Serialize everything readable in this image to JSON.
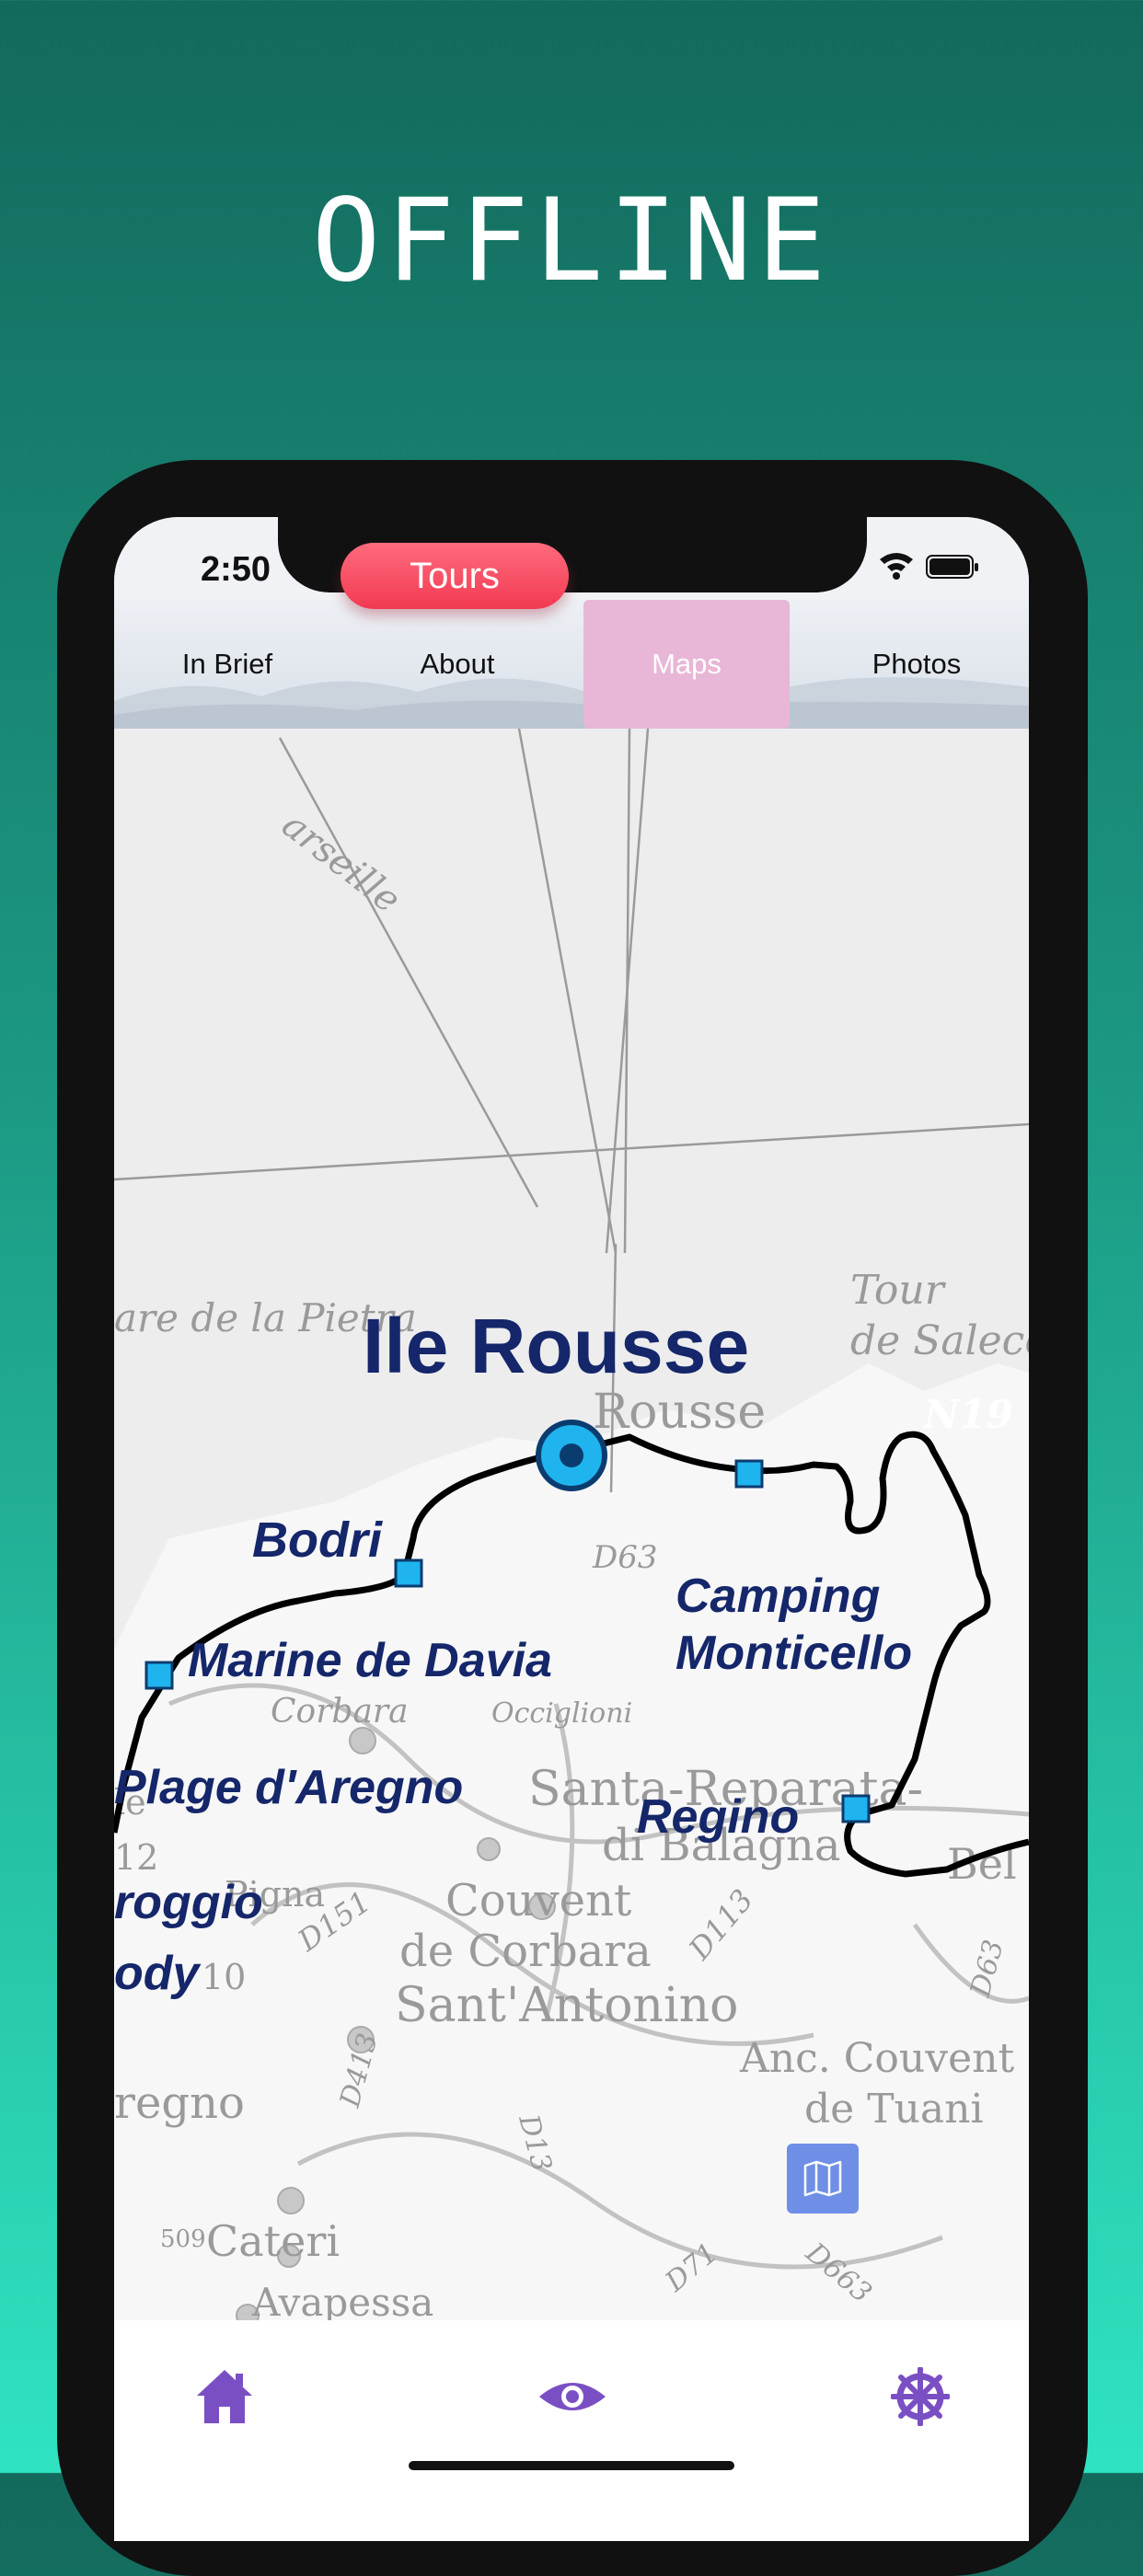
{
  "promo": {
    "headline": "OFFLINE"
  },
  "status_bar": {
    "time": "2:50"
  },
  "tabs": [
    {
      "label": "In Brief",
      "active": false
    },
    {
      "label": "About",
      "active": false
    },
    {
      "label": "Maps",
      "active": true
    },
    {
      "label": "Photos",
      "active": false
    }
  ],
  "map": {
    "tours_label": "Tours",
    "place_title": "Ile Rousse",
    "stops": [
      {
        "label": "Bodri"
      },
      {
        "label": "Marine de Davia"
      },
      {
        "label": "Plage d'Aregno"
      },
      {
        "label": "Camping"
      },
      {
        "label": "Monticello"
      },
      {
        "label": "Regino"
      },
      {
        "label": "roggio"
      },
      {
        "label": "ody"
      }
    ],
    "base_labels": [
      "are de la Pietra",
      "Tour",
      "de Salecci",
      "Rousse",
      "N19",
      "D63",
      "Corbara",
      "Occiglioni",
      "Santa-Reparata-",
      "di Balagna",
      "Couvent",
      "de Corbara",
      "Sant'Antonino",
      "D151",
      "D413",
      "D13",
      "D113",
      "Anc. Couvent",
      "de Tuani",
      "Pigna",
      "12",
      "10",
      "regno",
      "Cateri",
      "Avapessa",
      "509",
      "D71",
      "D663",
      "Bel",
      "D63",
      "arseille",
      "le"
    ]
  },
  "bottom_nav": [
    {
      "icon": "home-icon"
    },
    {
      "icon": "eye-icon"
    },
    {
      "icon": "settings-wheel-icon"
    }
  ],
  "colors": {
    "accent": "#7b4fc4",
    "tours": "#f23a52",
    "route_marker": "#1fb4ee",
    "active_tab": "#e8b6d6"
  }
}
